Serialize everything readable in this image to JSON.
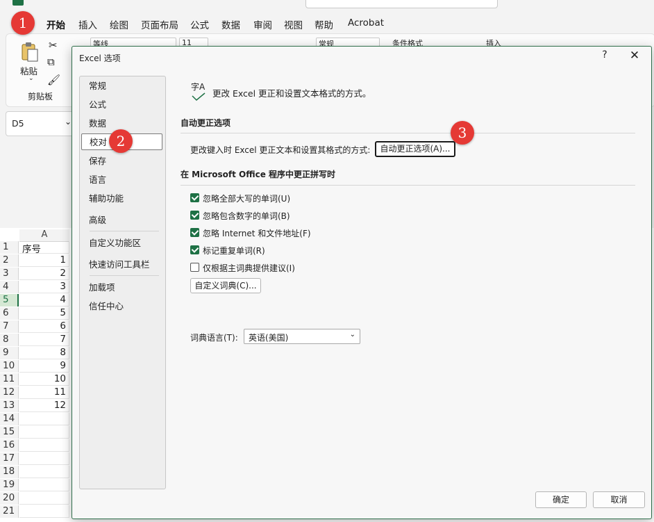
{
  "ribbon": {
    "tabs": [
      "开始",
      "插入",
      "绘图",
      "页面布局",
      "公式",
      "数据",
      "审阅",
      "视图",
      "帮助",
      "Acrobat"
    ],
    "active_tab": "开始",
    "paste_label": "粘贴",
    "clipboard_group": "剪贴板",
    "font_name": "等线",
    "font_size": "11",
    "number_format": "常规",
    "cond_format": "条件格式",
    "insert": "插入"
  },
  "namebox": {
    "value": "D5"
  },
  "sheet": {
    "column_header": "A",
    "rows": [
      {
        "n": "1",
        "a": "序号"
      },
      {
        "n": "2",
        "a": "1"
      },
      {
        "n": "3",
        "a": "2"
      },
      {
        "n": "4",
        "a": "3"
      },
      {
        "n": "5",
        "a": "4"
      },
      {
        "n": "6",
        "a": "5"
      },
      {
        "n": "7",
        "a": "6"
      },
      {
        "n": "8",
        "a": "7"
      },
      {
        "n": "9",
        "a": "8"
      },
      {
        "n": "10",
        "a": "9"
      },
      {
        "n": "11",
        "a": "10"
      },
      {
        "n": "12",
        "a": "11"
      },
      {
        "n": "13",
        "a": "12"
      },
      {
        "n": "14",
        "a": ""
      },
      {
        "n": "15",
        "a": ""
      },
      {
        "n": "16",
        "a": ""
      },
      {
        "n": "17",
        "a": ""
      },
      {
        "n": "18",
        "a": ""
      },
      {
        "n": "19",
        "a": ""
      },
      {
        "n": "20",
        "a": ""
      },
      {
        "n": "21",
        "a": ""
      }
    ]
  },
  "markers": [
    "1",
    "2",
    "3"
  ],
  "dialog": {
    "title": "Excel 选项",
    "help": "?",
    "close": "✕",
    "nav": [
      "常规",
      "公式",
      "数据",
      "校对",
      "保存",
      "语言",
      "辅助功能",
      "高级",
      "自定义功能区",
      "快速访问工具栏",
      "加载项",
      "信任中心"
    ],
    "selected_nav": "校对",
    "header_icon_text": "字A",
    "header_text": "更改 Excel 更正和设置文本格式的方式。",
    "autocorrect_section": "自动更正选项",
    "autocorrect_row_label": "更改键入时 Excel 更正文本和设置其格式的方式:",
    "autocorrect_button": "自动更正选项(A)...",
    "spelling_section": "在 Microsoft Office 程序中更正拼写时",
    "checkboxes": [
      {
        "label": "忽略全部大写的单词(U)",
        "checked": true
      },
      {
        "label": "忽略包含数字的单词(B)",
        "checked": true
      },
      {
        "label": "忽略 Internet 和文件地址(F)",
        "checked": true
      },
      {
        "label": "标记重复单词(R)",
        "checked": true
      },
      {
        "label": "仅根据主词典提供建议(I)",
        "checked": false
      }
    ],
    "custom_dict_button": "自定义词典(C)...",
    "dict_lang_label": "词典语言(T):",
    "dict_lang_value": "英语(美国)",
    "ok": "确定",
    "cancel": "取消"
  }
}
